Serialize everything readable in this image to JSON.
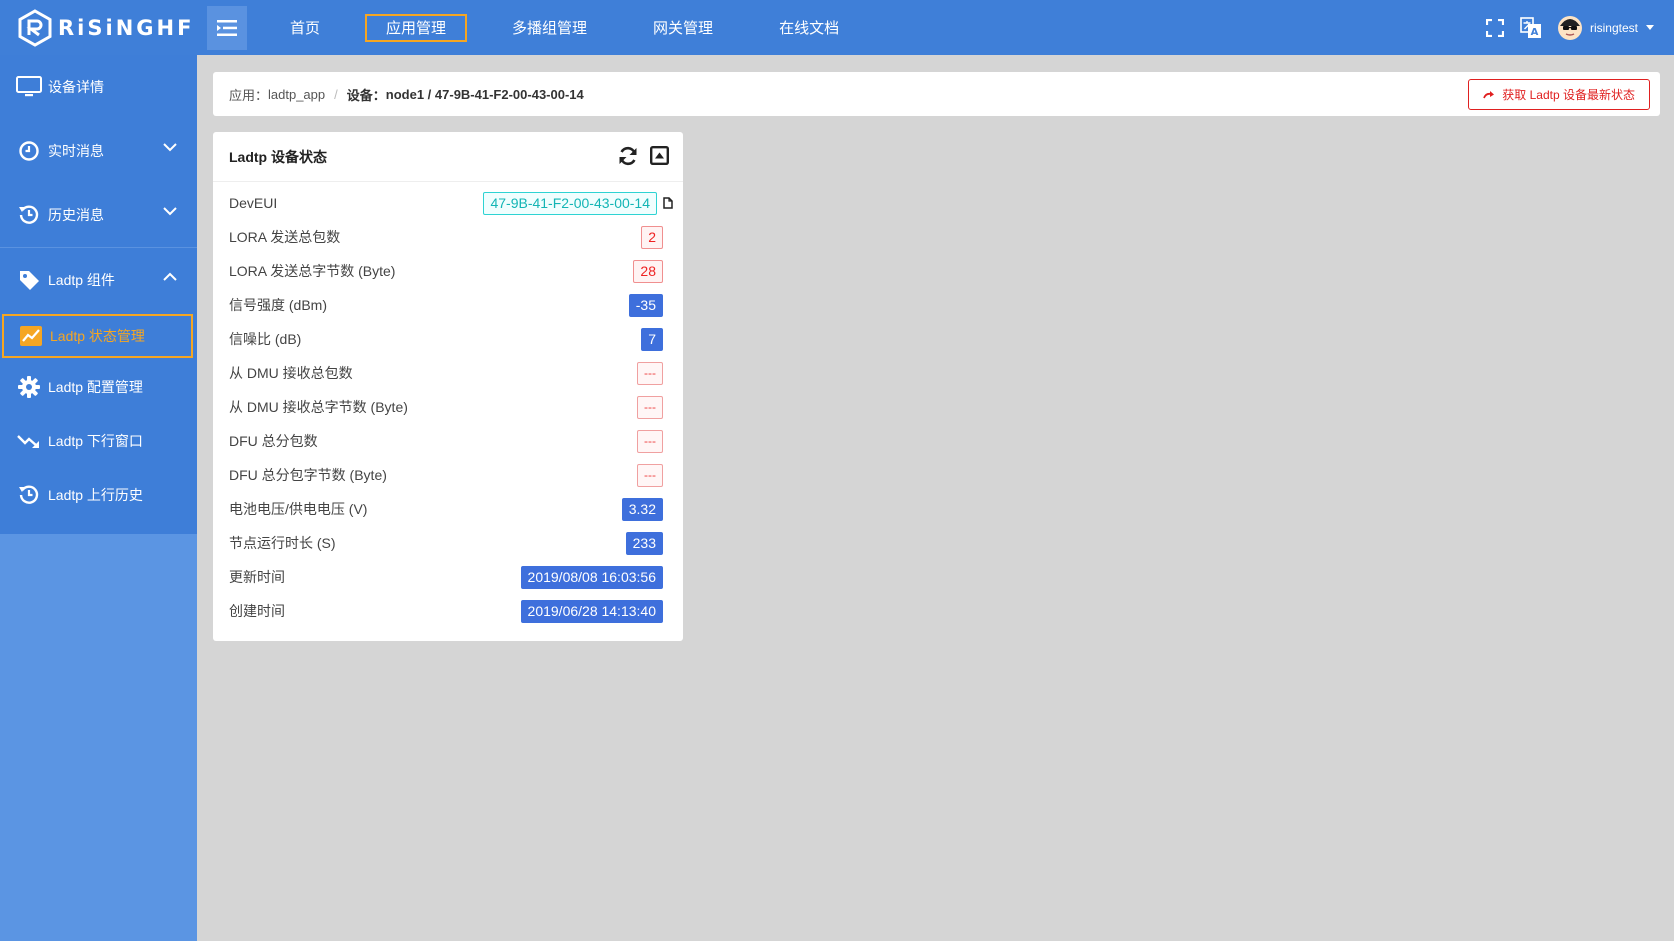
{
  "brand": {
    "logo_text": "RiSiNGHF"
  },
  "nav": {
    "items": [
      {
        "label": "首页",
        "active": false
      },
      {
        "label": "应用管理",
        "active": true
      },
      {
        "label": "多播组管理",
        "active": false
      },
      {
        "label": "网关管理",
        "active": false
      },
      {
        "label": "在线文档",
        "active": false
      }
    ]
  },
  "user": {
    "name": "risingtest"
  },
  "sidebar": {
    "items": [
      {
        "label": "设备详情",
        "icon": "monitor-icon"
      },
      {
        "label": "实时消息",
        "icon": "clock-icon",
        "expand": "down"
      },
      {
        "label": "历史消息",
        "icon": "history-icon",
        "expand": "down"
      },
      {
        "label": "Ladtp 组件",
        "icon": "tag-icon",
        "expand": "up"
      },
      {
        "label": "Ladtp 状态管理",
        "icon": "chart-icon",
        "active": true
      },
      {
        "label": "Ladtp 配置管理",
        "icon": "gear-icon"
      },
      {
        "label": "Ladtp 下行窗口",
        "icon": "trend-down-icon"
      },
      {
        "label": "Ladtp 上行历史",
        "icon": "history-icon"
      }
    ]
  },
  "breadcrumb": {
    "app_prefix": "应用：",
    "app_name": "ladtp_app",
    "device_prefix": "设备：",
    "device_path": "node1 / 47-9B-41-F2-00-43-00-14",
    "fetch_button": "获取 Ladtp 设备最新状态"
  },
  "status_card": {
    "title": "Ladtp 设备状态",
    "rows": [
      {
        "label": "DevEUI",
        "value": "47-9B-41-F2-00-43-00-14"
      },
      {
        "label": "LORA 发送总包数",
        "value": "2"
      },
      {
        "label": "LORA 发送总字节数 (Byte)",
        "value": "28"
      },
      {
        "label": "信号强度 (dBm)",
        "value": "-35"
      },
      {
        "label": "信噪比 (dB)",
        "value": "7"
      },
      {
        "label": "从 DMU 接收总包数",
        "value": "---"
      },
      {
        "label": "从 DMU 接收总字节数 (Byte)",
        "value": "---"
      },
      {
        "label": "DFU 总分包数",
        "value": "---"
      },
      {
        "label": "DFU 总分包字节数 (Byte)",
        "value": "---"
      },
      {
        "label": "电池电压/供电电压 (V)",
        "value": "3.32"
      },
      {
        "label": "节点运行时长 (S)",
        "value": "233"
      },
      {
        "label": "更新时间",
        "value": "2019/08/08 16:03:56"
      },
      {
        "label": "创建时间",
        "value": "2019/06/28 14:13:40"
      }
    ]
  },
  "colors": {
    "topbar": "#3f7fd8",
    "sidebar": "#5b95e3",
    "accent": "#f5a623",
    "danger": "#e02020",
    "badge_blue": "#3e6fdc",
    "badge_cyan": "#13b5b5"
  }
}
